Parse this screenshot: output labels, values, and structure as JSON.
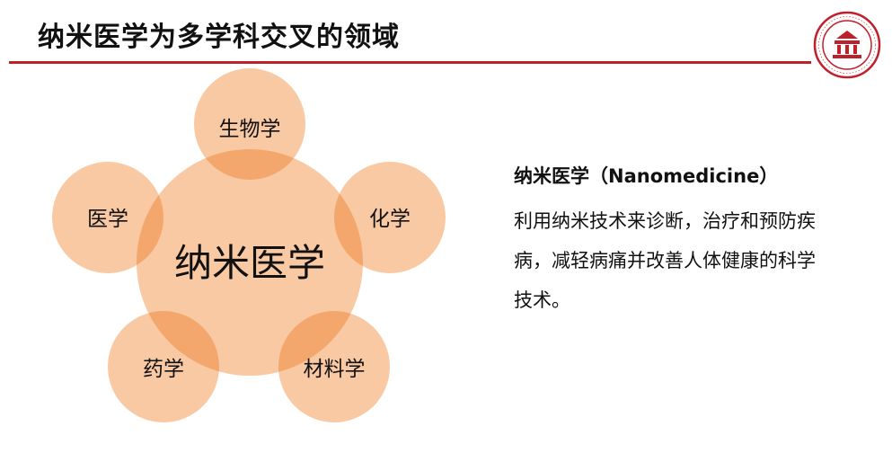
{
  "slide": {
    "title": "纳米医学为多学科交叉的领域",
    "logo_icon": "university-seal-icon",
    "accent_color": "#c0202a"
  },
  "diagram": {
    "center": "纳米医学",
    "satellites": [
      "生物学",
      "化学",
      "材料学",
      "药学",
      "医学"
    ],
    "fill_color": "#f9c9a3",
    "overlap_color": "#f4a76c"
  },
  "description": {
    "heading": "纳米医学（Nanomedicine）",
    "body": "利用纳米技术来诊断，治疗和预防疾病，减轻病痛并改善人体健康的科学技术。"
  }
}
